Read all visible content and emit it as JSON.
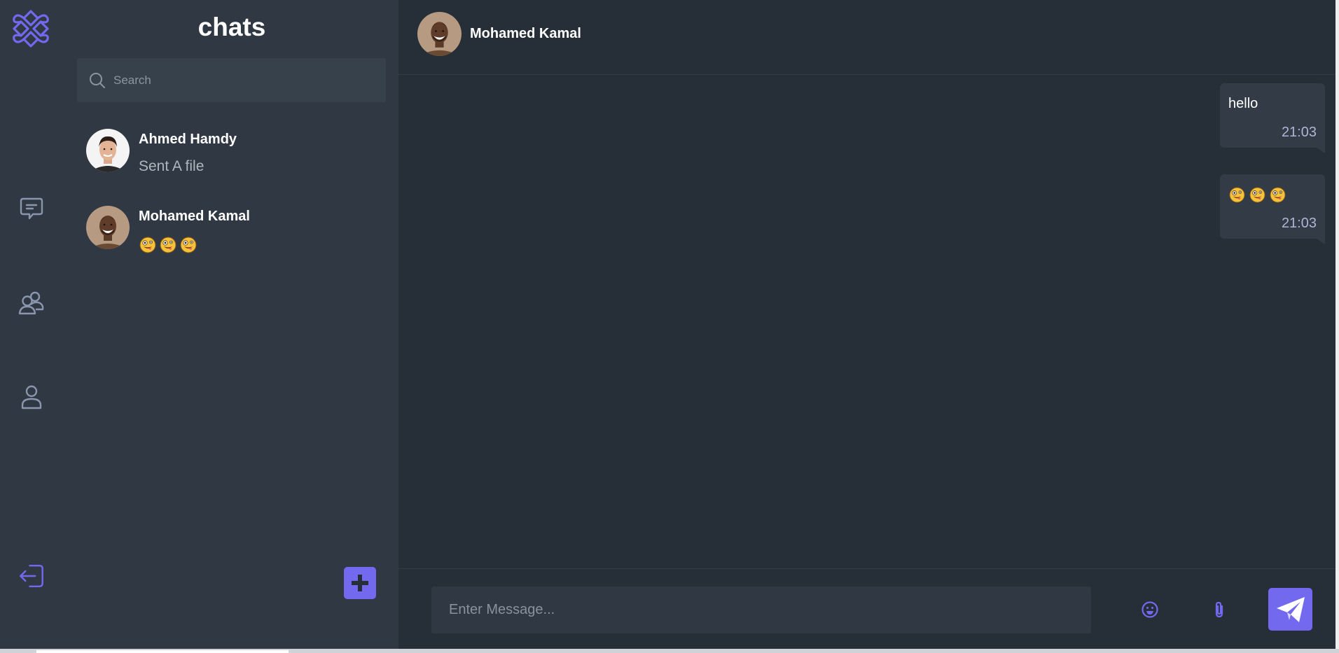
{
  "rail": {
    "logo_icon": "celtic-knot-logo",
    "items": [
      {
        "name": "chats",
        "icon": "chat-bubble-icon"
      },
      {
        "name": "groups",
        "icon": "users-icon"
      },
      {
        "name": "profile",
        "icon": "user-icon"
      }
    ],
    "logout_icon": "logout-icon"
  },
  "panel": {
    "title": "chats",
    "search": {
      "placeholder": "Search"
    },
    "chats": [
      {
        "name": "Ahmed Hamdy",
        "preview": "Sent A file"
      },
      {
        "name": "Mohamed Kamal",
        "preview_emojis": [
          "zany-face",
          "zany-face",
          "zany-face"
        ]
      }
    ],
    "add_button_icon": "plus-icon"
  },
  "conversation": {
    "contact_name": "Mohamed Kamal",
    "messages": [
      {
        "text": "hello",
        "time": "21:03"
      },
      {
        "emojis": [
          "zany-face",
          "zany-face",
          "zany-face"
        ],
        "time": "21:03"
      }
    ],
    "composer": {
      "placeholder": "Enter Message...",
      "emoji_icon": "smile-icon",
      "attach_icon": "paperclip-icon",
      "send_icon": "send-icon"
    }
  },
  "colors": {
    "accent": "#7269ef",
    "rail_bg": "#2f3843",
    "panel_bg": "#303843",
    "conversation_bg": "#262e37",
    "bubble_bg": "#323b46"
  }
}
